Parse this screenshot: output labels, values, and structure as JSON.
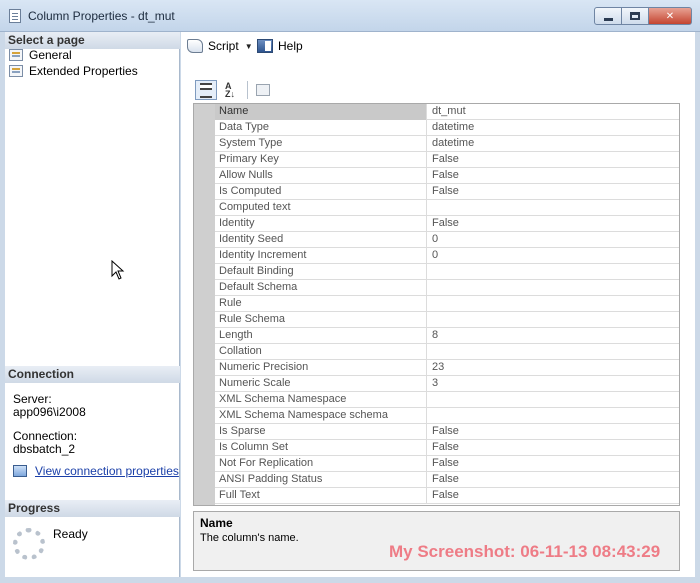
{
  "window": {
    "title": "Column Properties - dt_mut",
    "close_glyph": "✕"
  },
  "left": {
    "select_page_header": "Select a page",
    "pages": [
      {
        "label": "General"
      },
      {
        "label": "Extended Properties"
      }
    ],
    "connection_header": "Connection",
    "server_label": "Server:",
    "server_value": "app096\\i2008",
    "connection_label": "Connection:",
    "connection_value": "dbsbatch_2",
    "view_connection_link": "View connection properties",
    "progress_header": "Progress",
    "progress_status": "Ready"
  },
  "toolbar": {
    "script_label": "Script",
    "help_label": "Help"
  },
  "properties": [
    {
      "name": "Name",
      "value": "dt_mut"
    },
    {
      "name": "Data Type",
      "value": "datetime"
    },
    {
      "name": "System Type",
      "value": "datetime"
    },
    {
      "name": "Primary Key",
      "value": "False"
    },
    {
      "name": "Allow Nulls",
      "value": "False"
    },
    {
      "name": "Is Computed",
      "value": "False"
    },
    {
      "name": "Computed text",
      "value": ""
    },
    {
      "name": "Identity",
      "value": "False"
    },
    {
      "name": "Identity Seed",
      "value": "0"
    },
    {
      "name": "Identity Increment",
      "value": "0"
    },
    {
      "name": "Default Binding",
      "value": ""
    },
    {
      "name": "Default Schema",
      "value": ""
    },
    {
      "name": "Rule",
      "value": ""
    },
    {
      "name": "Rule Schema",
      "value": ""
    },
    {
      "name": "Length",
      "value": "8"
    },
    {
      "name": "Collation",
      "value": ""
    },
    {
      "name": "Numeric Precision",
      "value": "23"
    },
    {
      "name": "Numeric Scale",
      "value": "3"
    },
    {
      "name": "XML Schema Namespace",
      "value": ""
    },
    {
      "name": "XML Schema Namespace schema",
      "value": ""
    },
    {
      "name": "Is Sparse",
      "value": "False"
    },
    {
      "name": "Is Column Set",
      "value": "False"
    },
    {
      "name": "Not For Replication",
      "value": "False"
    },
    {
      "name": "ANSI Padding Status",
      "value": "False"
    },
    {
      "name": "Full Text",
      "value": "False"
    }
  ],
  "description": {
    "title": "Name",
    "text": "The column's name."
  },
  "watermark": "My Screenshot: 06-11-13 08:43:29"
}
